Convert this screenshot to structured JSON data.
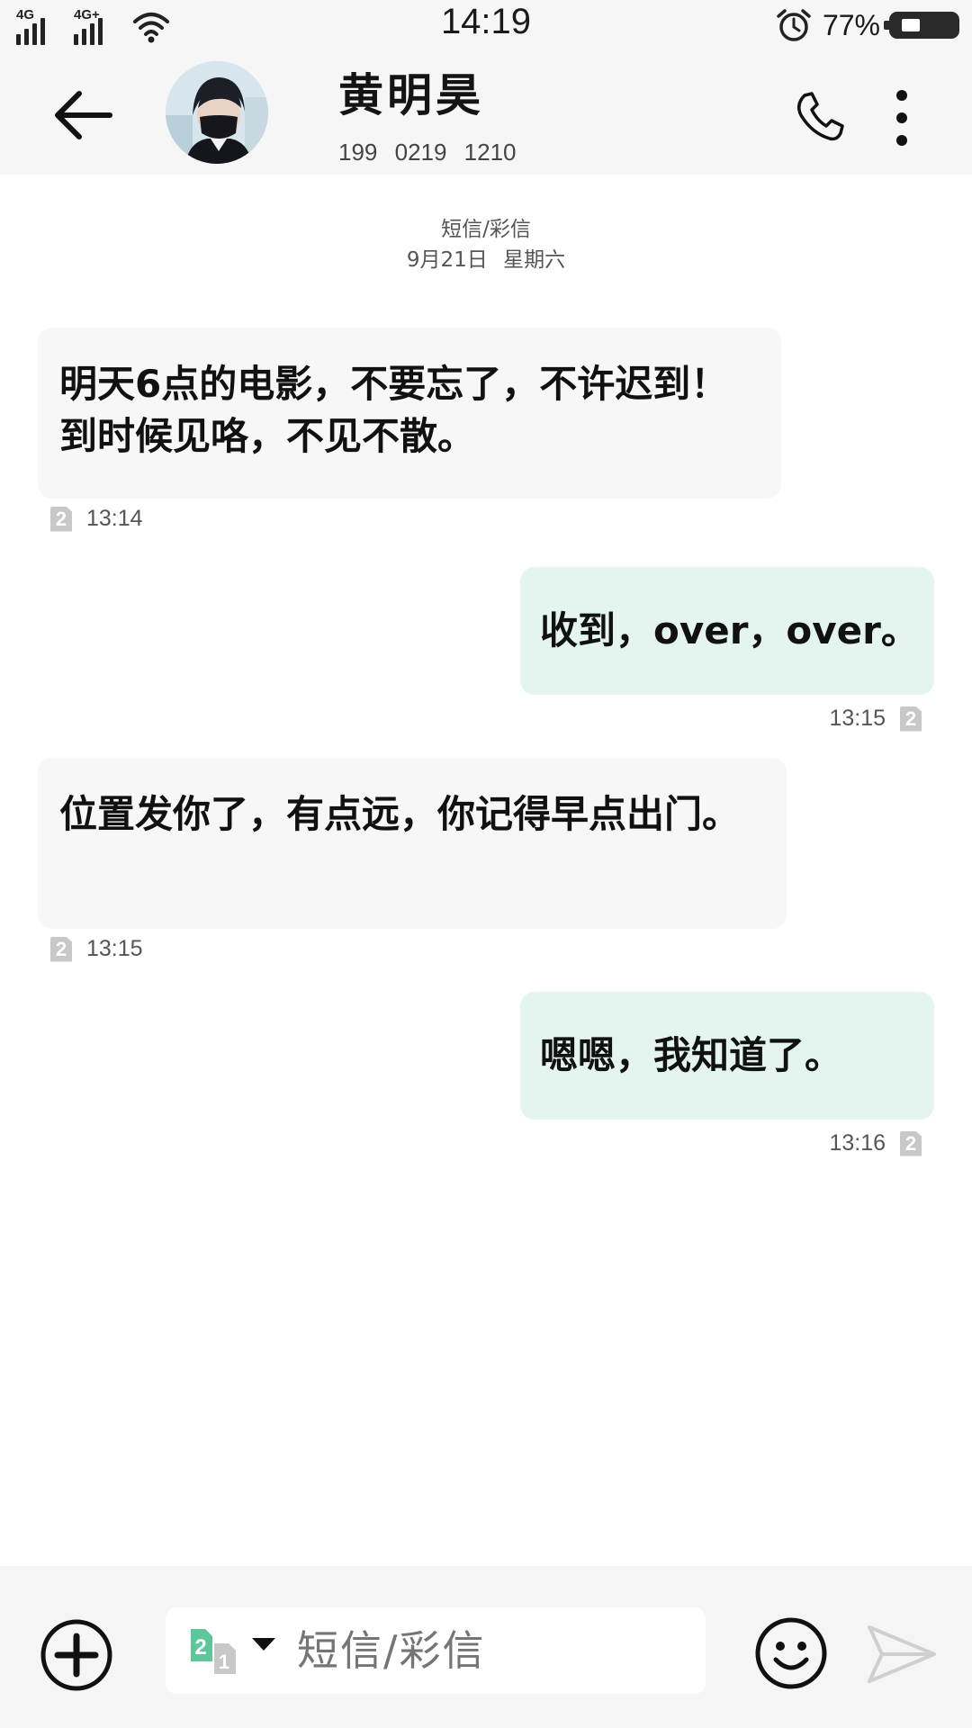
{
  "status_bar": {
    "signal1_label": "4G",
    "signal2_label": "4G+",
    "time": "14:19",
    "battery_percent": "77%",
    "battery_level": 0.77
  },
  "header": {
    "contact_name": "黄明昊",
    "contact_phone": "199 0219 1210"
  },
  "conversation": {
    "channel_label": "短信/彩信",
    "date_label": "9月21日 星期六"
  },
  "messages": [
    {
      "direction": "incoming",
      "text": "明天6点的电影，不要忘了，不许迟到！到时候见咯，不见不散。",
      "time": "13:14",
      "sim": "2"
    },
    {
      "direction": "outgoing",
      "text": "收到，over，over。",
      "time": "13:15",
      "sim": "2"
    },
    {
      "direction": "incoming",
      "text": "位置发你了，有点远，你记得早点出门。",
      "time": "13:15",
      "sim": "2"
    },
    {
      "direction": "outgoing",
      "text": "嗯嗯，我知道了。",
      "time": "13:16",
      "sim": "2"
    }
  ],
  "composer": {
    "sim_primary": "2",
    "sim_secondary": "1",
    "placeholder": "短信/彩信"
  },
  "colors": {
    "incoming_bubble": "#f7f7f7",
    "outgoing_bubble": "#e3f5ee",
    "sim_selected": "#5cc89a",
    "bar_background": "#f6f6f6"
  }
}
